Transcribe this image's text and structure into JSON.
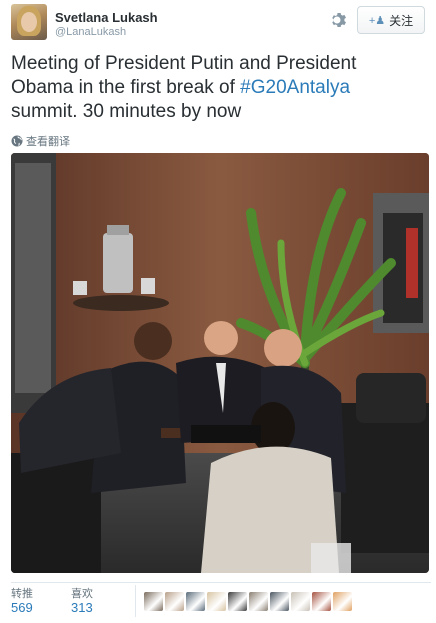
{
  "user": {
    "display_name": "Svetlana Lukash",
    "handle": "@LanaLukash"
  },
  "icons": {
    "settings": "gear-icon",
    "follow": "add-user-icon",
    "translate": "globe-icon"
  },
  "follow_button": {
    "label": "关注"
  },
  "tweet": {
    "text_before": "Meeting of President Putin and President Obama in the first break of ",
    "hashtag": "#G20Antalya",
    "text_after": " summit. 30 minutes by now"
  },
  "translate": {
    "label": "查看翻译"
  },
  "stats": {
    "retweets_label": "转推",
    "retweets": "569",
    "favorites_label": "喜欢",
    "favorites": "313"
  },
  "favoriters": [
    {
      "color": "#7a6b5c"
    },
    {
      "color": "#b8a089"
    },
    {
      "color": "#5a6b7a"
    },
    {
      "color": "#d7c3a1"
    },
    {
      "color": "#3b3b3b"
    },
    {
      "color": "#8a7f72"
    },
    {
      "color": "#4a5560"
    },
    {
      "color": "#c8c0b5"
    },
    {
      "color": "#a5523f"
    },
    {
      "color": "#e0a060"
    }
  ],
  "colors": {
    "link": "#2b7bb9",
    "muted": "#8899a6"
  }
}
